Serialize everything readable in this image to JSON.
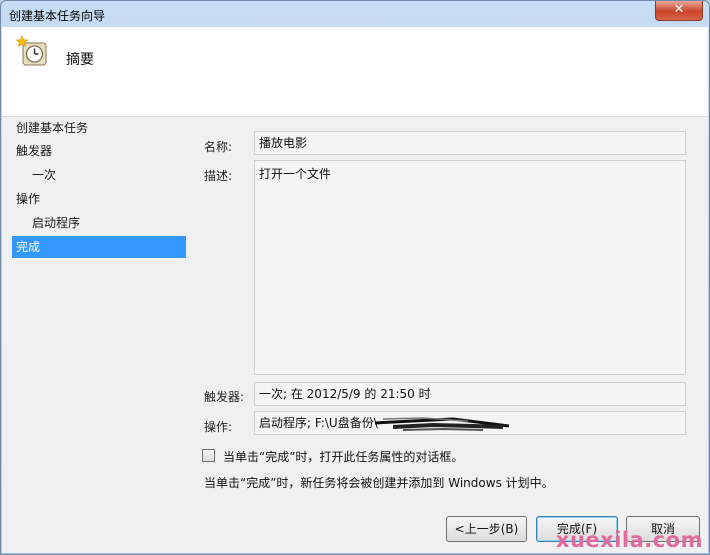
{
  "window": {
    "title": "创建基本任务向导",
    "close_symbol": "✕"
  },
  "header": {
    "title": "摘要",
    "icon": "clock-star-icon"
  },
  "nav": {
    "items": [
      {
        "label": "创建基本任务",
        "sub": false,
        "selected": false
      },
      {
        "label": "触发器",
        "sub": false,
        "selected": false
      },
      {
        "label": "一次",
        "sub": true,
        "selected": false
      },
      {
        "label": "操作",
        "sub": false,
        "selected": false
      },
      {
        "label": "启动程序",
        "sub": true,
        "selected": false
      },
      {
        "label": "完成",
        "sub": false,
        "selected": true
      }
    ]
  },
  "summary": {
    "name_label": "名称:",
    "name_value": "播放电影",
    "desc_label": "描述:",
    "desc_value": "打开一个文件",
    "trigger_label": "触发器:",
    "trigger_value": "一次; 在 2012/5/9 的 21:50 时",
    "action_label": "操作:",
    "action_value": "启动程序; F:\\U盘备份\\"
  },
  "options": {
    "open_properties_label": "当单击“完成”时，打开此任务属性的对话框。",
    "open_properties_checked": false,
    "info_text": "当单击“完成”时，新任务将会被创建并添加到 Windows 计划中。"
  },
  "buttons": {
    "back": "<上一步(B)",
    "finish": "完成(F)",
    "cancel": "取消"
  },
  "watermark": "xuexila.com",
  "colors": {
    "selection": "#3399ff",
    "watermark": "#e06b9c"
  }
}
